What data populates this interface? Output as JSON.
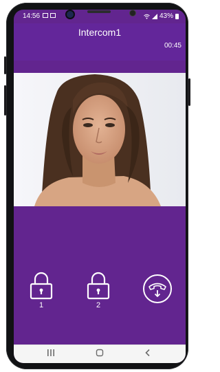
{
  "status_bar": {
    "time": "14:56",
    "battery_percent": "43%",
    "left_icons": [
      "notification-icon",
      "image-icon"
    ],
    "right_icons": [
      "wifi-icon",
      "signal-icon",
      "battery-icon"
    ]
  },
  "header": {
    "title": "Intercom1",
    "call_timer": "00:45"
  },
  "video": {
    "content": "video-feed"
  },
  "controls": {
    "lock_1": {
      "label": "1",
      "icon": "lock-icon"
    },
    "lock_2": {
      "label": "2",
      "icon": "lock-icon"
    },
    "hangup": {
      "icon": "hangup-phone-icon"
    }
  },
  "navbar": {
    "recents": "recents-icon",
    "home": "home-icon",
    "back": "back-icon"
  },
  "colors": {
    "accent": "#62258f",
    "header": "#63269a",
    "navbar": "#f5f5f5",
    "text": "#ffffff"
  }
}
